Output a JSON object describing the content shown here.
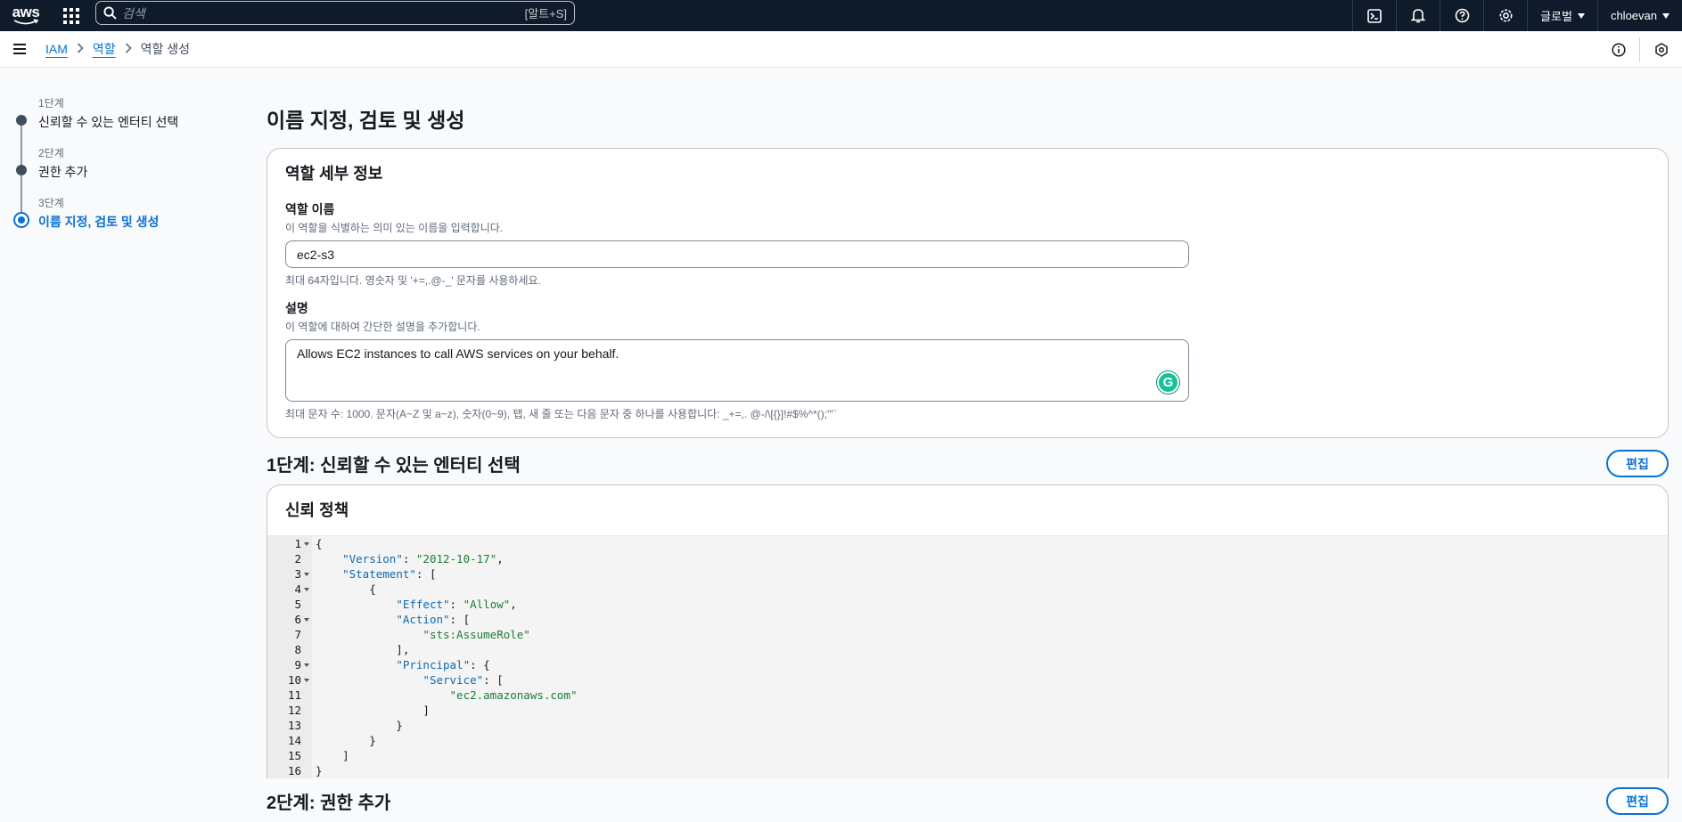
{
  "topnav": {
    "logo": "aws",
    "search_placeholder": "검색",
    "search_shortcut": "[알트+S]",
    "region": "글로벌",
    "user": "chloevan",
    "icons": [
      "cloudshell-icon",
      "bell-icon",
      "help-icon",
      "gear-icon"
    ]
  },
  "breadcrumb": {
    "items": [
      "IAM",
      "역할"
    ],
    "current": "역할 생성"
  },
  "steps": [
    {
      "num": "1단계",
      "label": "신뢰할 수 있는 엔터티 선택"
    },
    {
      "num": "2단계",
      "label": "권한 추가"
    },
    {
      "num": "3단계",
      "label": "이름 지정, 검토 및 생성"
    }
  ],
  "page": {
    "title": "이름 지정, 검토 및 생성"
  },
  "details": {
    "heading": "역할 세부 정보",
    "name_label": "역할 이름",
    "name_desc": "이 역할을 식별하는 의미 있는 이름을 입력합니다.",
    "name_value": "ec2-s3",
    "name_hint": "최대 64자입니다. 영숫자 및 '+=,.@-_' 문자를 사용하세요.",
    "desc_label": "설명",
    "desc_desc": "이 역할에 대하여 간단한 설명을 추가합니다.",
    "desc_value": "Allows EC2 instances to call AWS services on your behalf.",
    "desc_hint": "최대 문자 수: 1000. 문자(A~Z 및 a~z), 숫자(0~9), 탭, 새 줄 또는 다음 문자 중 하나를 사용합니다: _+=,. @-/\\[{}]!#$%^*();'\"`"
  },
  "step1": {
    "heading": "1단계: 신뢰할 수 있는 엔터티 선택",
    "edit_label": "편집",
    "policy_heading": "신뢰 정책",
    "code_lines": [
      {
        "n": "1",
        "fold": true
      },
      {
        "n": "2",
        "fold": false
      },
      {
        "n": "3",
        "fold": true
      },
      {
        "n": "4",
        "fold": true
      },
      {
        "n": "5",
        "fold": false
      },
      {
        "n": "6",
        "fold": true
      },
      {
        "n": "7",
        "fold": false
      },
      {
        "n": "8",
        "fold": false
      },
      {
        "n": "9",
        "fold": true
      },
      {
        "n": "10",
        "fold": true
      },
      {
        "n": "11",
        "fold": false
      },
      {
        "n": "12",
        "fold": false
      },
      {
        "n": "13",
        "fold": false
      },
      {
        "n": "14",
        "fold": false
      },
      {
        "n": "15",
        "fold": false
      },
      {
        "n": "16",
        "fold": false
      }
    ],
    "code": {
      "l1": "{",
      "version_key": "\"Version\"",
      "version_val": "\"2012-10-17\"",
      "statement_key": "\"Statement\"",
      "open_obj": "{",
      "effect_key": "\"Effect\"",
      "effect_val": "\"Allow\"",
      "action_key": "\"Action\"",
      "action_val": "\"sts:AssumeRole\"",
      "principal_key": "\"Principal\"",
      "service_key": "\"Service\"",
      "service_val": "\"ec2.amazonaws.com\"",
      "l16": "}"
    }
  },
  "step2": {
    "heading": "2단계: 권한 추가",
    "edit_label": "편집"
  }
}
